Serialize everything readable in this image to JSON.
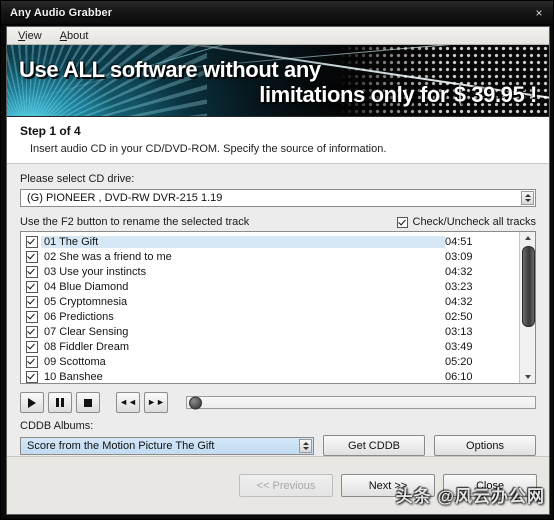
{
  "window": {
    "title": "Any Audio Grabber",
    "close_label": "×"
  },
  "menubar": {
    "items": [
      {
        "accesskey": "V",
        "rest": "iew"
      },
      {
        "accesskey": "A",
        "rest": "bout"
      }
    ]
  },
  "banner": {
    "line1": "Use ALL software without any",
    "line2": "limitations only for $ 39.95 !",
    "price": "$ 39.95"
  },
  "step": {
    "title": "Step 1 of 4",
    "description": "Insert audio CD in your CD/DVD-ROM. Specify the source of information."
  },
  "drive": {
    "label": "Please select CD drive:",
    "selected": "(G) PIONEER , DVD-RW  DVR-215  1.19"
  },
  "tracklist": {
    "hint": "Use the F2 button to rename the selected track",
    "check_all_label": "Check/Uncheck all tracks",
    "check_all_checked": true,
    "tracks": [
      {
        "num": "01",
        "name": "01 The Gift",
        "time": "04:51",
        "checked": true,
        "selected": true
      },
      {
        "num": "02",
        "name": "02 She was a friend to me",
        "time": "03:09",
        "checked": true,
        "selected": false
      },
      {
        "num": "03",
        "name": "03 Use your instincts",
        "time": "04:32",
        "checked": true,
        "selected": false
      },
      {
        "num": "04",
        "name": "04 Blue Diamond",
        "time": "03:23",
        "checked": true,
        "selected": false
      },
      {
        "num": "05",
        "name": "05 Cryptomnesia",
        "time": "04:32",
        "checked": true,
        "selected": false
      },
      {
        "num": "06",
        "name": "06 Predictions",
        "time": "02:50",
        "checked": true,
        "selected": false
      },
      {
        "num": "07",
        "name": "07 Clear Sensing",
        "time": "03:13",
        "checked": true,
        "selected": false
      },
      {
        "num": "08",
        "name": "08 Fiddler Dream",
        "time": "03:49",
        "checked": true,
        "selected": false
      },
      {
        "num": "09",
        "name": "09 Scottoma",
        "time": "05:20",
        "checked": true,
        "selected": false
      },
      {
        "num": "10",
        "name": "10 Banshee",
        "time": "06:10",
        "checked": true,
        "selected": false
      }
    ]
  },
  "transport": {
    "play": "play-icon",
    "pause": "pause-icon",
    "stop": "stop-icon",
    "rewind": "◄◄",
    "forward": "►►",
    "position_percent": 0
  },
  "cddb": {
    "label": "CDDB Albums:",
    "selected_album": "Score from the Motion Picture The Gift",
    "get_button": "Get CDDB",
    "options_button": "Options"
  },
  "footer": {
    "previous": "<< Previous",
    "previous_disabled": true,
    "next": "Next >>",
    "close": "Close"
  },
  "watermark": {
    "text": "头条 @风云办公网"
  },
  "colors": {
    "titlebar": "#161616",
    "client_bg": "#ececec",
    "selection": "#d6e7f5",
    "banner_teal": "#0c3a46"
  }
}
